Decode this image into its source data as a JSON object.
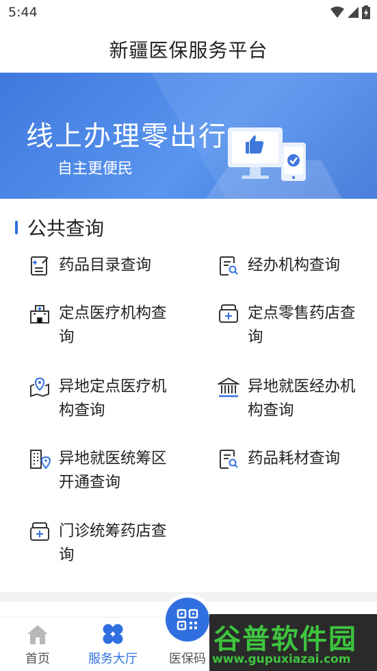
{
  "status_bar": {
    "time": "5:44"
  },
  "header": {
    "title": "新疆医保服务平台"
  },
  "banner": {
    "heading": "线上办理零出行",
    "subtitle": "自主更便民"
  },
  "section": {
    "title": "公共查询"
  },
  "services": [
    {
      "label": "药品目录查询",
      "icon": "drug-catalog-icon"
    },
    {
      "label": "经办机构查询",
      "icon": "document-search-icon"
    },
    {
      "label": "定点医疗机构查询",
      "icon": "hospital-icon"
    },
    {
      "label": "定点零售药店查询",
      "icon": "medicine-box-icon"
    },
    {
      "label": "异地定点医疗机构查询",
      "icon": "map-location-icon"
    },
    {
      "label": "异地就医经办机构查询",
      "icon": "institution-building-icon"
    },
    {
      "label": "异地就医统筹区开通查询",
      "icon": "building-location-icon"
    },
    {
      "label": "药品耗材查询",
      "icon": "document-search-icon"
    },
    {
      "label": "门诊统筹药店查询",
      "icon": "medicine-box-icon"
    }
  ],
  "bottom_nav": {
    "items": [
      {
        "label": "首页",
        "icon": "home-icon",
        "active": false
      },
      {
        "label": "服务大厅",
        "icon": "service-hall-icon",
        "active": true
      },
      {
        "label": "医保码",
        "icon": "qr-code-icon",
        "active": false
      }
    ]
  },
  "watermark": {
    "title": "谷普软件园",
    "url": "www.gupuxiazai.com"
  },
  "colors": {
    "accent": "#2f6fe0",
    "banner": "#4a86e8",
    "watermark_green": "#3ec43e"
  }
}
